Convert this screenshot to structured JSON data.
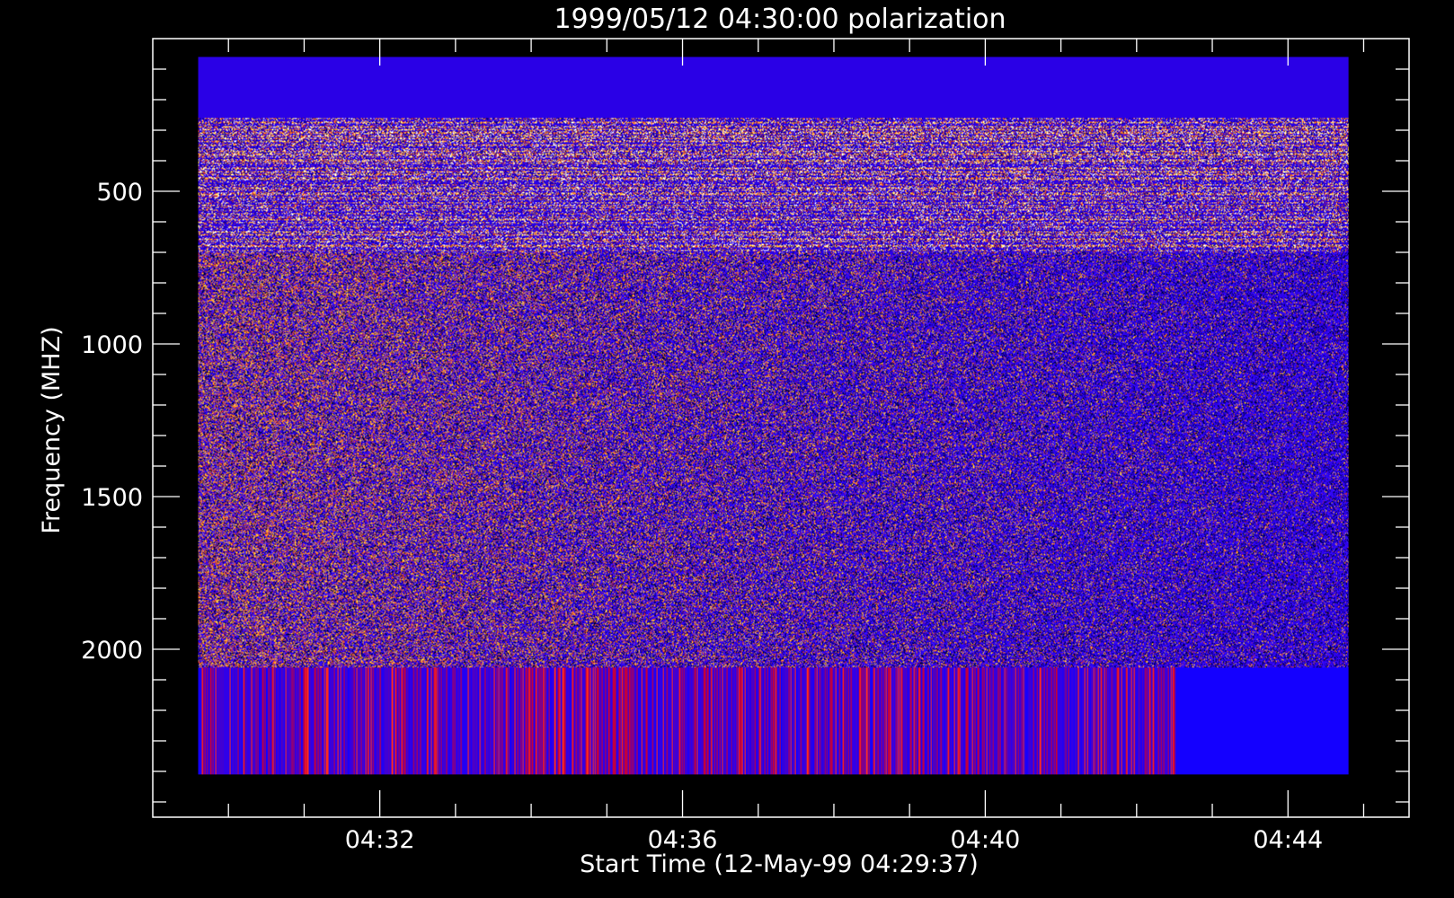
{
  "chart_data": {
    "type": "heatmap",
    "title": "1999/05/12 04:30:00 polarization",
    "xlabel": "Start Time (12-May-99 04:29:37)",
    "ylabel": "Frequency (MHZ)",
    "x_start": "04:29:37",
    "x_end": "04:44:48",
    "xlim_minutes": [
      29.0,
      45.6
    ],
    "x_ticks": [
      {
        "label": "04:32",
        "minute": 32
      },
      {
        "label": "04:36",
        "minute": 36
      },
      {
        "label": "04:40",
        "minute": 40
      },
      {
        "label": "04:44",
        "minute": 44
      }
    ],
    "x_minor_ticks_minutes": [
      30,
      31,
      33,
      34,
      35,
      37,
      38,
      39,
      41,
      42,
      43,
      45
    ],
    "y_reversed": true,
    "ylim": [
      0,
      2550
    ],
    "y_ticks": [
      {
        "label": "500",
        "value": 500
      },
      {
        "label": "1000",
        "value": 1000
      },
      {
        "label": "1500",
        "value": 1500
      },
      {
        "label": "2000",
        "value": 2000
      }
    ],
    "y_minor_ticks": [
      100,
      200,
      300,
      400,
      600,
      700,
      800,
      900,
      1100,
      1200,
      1300,
      1400,
      1600,
      1700,
      1800,
      1900,
      2100,
      2200,
      2300,
      2400,
      2500
    ],
    "image_extent": {
      "x_minutes": [
        29.6,
        44.8
      ],
      "y_mhz": [
        60,
        2410
      ]
    },
    "bands": [
      {
        "y_mhz": [
          60,
          260
        ],
        "description": "uniform",
        "color": "#2a00e6"
      },
      {
        "y_mhz": [
          260,
          700
        ],
        "description": "strong horizontal striping",
        "palette": [
          "#2a00e6",
          "#d83030",
          "#ff8a20",
          "#ffe060",
          "#10006a",
          "#ffffff"
        ]
      },
      {
        "y_mhz": [
          700,
          2060
        ],
        "description": "speckled noise, fading right",
        "palette": [
          "#2a00e6",
          "#3a10ff",
          "#c02848",
          "#ff7a20",
          "#ffd040",
          "#000040"
        ]
      },
      {
        "y_mhz": [
          2060,
          2410
        ],
        "description": "vertical stripes",
        "palette": [
          "#3000e8",
          "#5000c0",
          "#c00040",
          "#ff2a20",
          "#1400ff"
        ]
      }
    ],
    "colors": {
      "background": "#000000",
      "axes": "#ffffff",
      "base": "#2a00e6"
    }
  }
}
